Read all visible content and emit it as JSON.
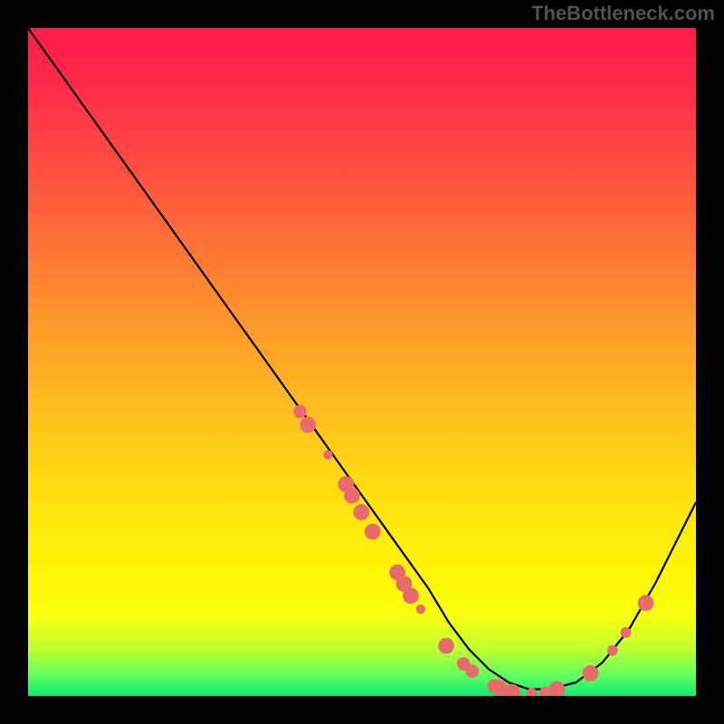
{
  "watermark": "TheBottleneck.com",
  "chart_data": {
    "type": "line",
    "title": "",
    "xlabel": "",
    "ylabel": "",
    "xlim": [
      0,
      100
    ],
    "ylim": [
      0,
      100
    ],
    "grid": false,
    "legend": false,
    "series": [
      {
        "name": "curve",
        "x": [
          0,
          5,
          10,
          15,
          20,
          25,
          30,
          35,
          40,
          45,
          50,
          55,
          60,
          63,
          66,
          69,
          72,
          75,
          78,
          82,
          86,
          90,
          94,
          98,
          100
        ],
        "y": [
          100,
          93,
          86,
          79,
          72,
          65,
          58,
          51,
          44,
          37,
          30,
          23,
          16,
          11,
          7,
          4,
          2,
          1,
          1,
          2,
          5,
          10,
          17,
          25,
          29
        ]
      }
    ],
    "scatter_points": {
      "name": "dots",
      "points": [
        {
          "x": 40.7,
          "y": 42.6,
          "r": 1.0
        },
        {
          "x": 41.9,
          "y": 40.6,
          "r": 1.2
        },
        {
          "x": 44.9,
          "y": 36.1,
          "r": 0.7
        },
        {
          "x": 47.6,
          "y": 31.7,
          "r": 1.2
        },
        {
          "x": 48.5,
          "y": 30.0,
          "r": 1.2
        },
        {
          "x": 49.9,
          "y": 27.5,
          "r": 1.2
        },
        {
          "x": 51.6,
          "y": 24.6,
          "r": 1.2
        },
        {
          "x": 55.3,
          "y": 18.5,
          "r": 1.2
        },
        {
          "x": 56.3,
          "y": 16.8,
          "r": 1.2
        },
        {
          "x": 57.3,
          "y": 15.0,
          "r": 1.2
        },
        {
          "x": 58.8,
          "y": 13.0,
          "r": 0.7
        },
        {
          "x": 62.6,
          "y": 7.5,
          "r": 1.2
        },
        {
          "x": 65.2,
          "y": 4.8,
          "r": 1.0
        },
        {
          "x": 66.5,
          "y": 3.7,
          "r": 1.0
        },
        {
          "x": 69.8,
          "y": 1.5,
          "r": 1.0
        },
        {
          "x": 70.5,
          "y": 1.2,
          "r": 1.2
        },
        {
          "x": 72.5,
          "y": 0.6,
          "r": 1.2
        },
        {
          "x": 75.4,
          "y": 0.4,
          "r": 0.8
        },
        {
          "x": 77.4,
          "y": 0.6,
          "r": 0.8
        },
        {
          "x": 79.2,
          "y": 1.0,
          "r": 1.2
        },
        {
          "x": 84.2,
          "y": 3.4,
          "r": 1.2
        },
        {
          "x": 87.5,
          "y": 6.8,
          "r": 0.8
        },
        {
          "x": 89.5,
          "y": 9.5,
          "r": 0.8
        },
        {
          "x": 92.5,
          "y": 13.9,
          "r": 1.2
        }
      ]
    }
  }
}
